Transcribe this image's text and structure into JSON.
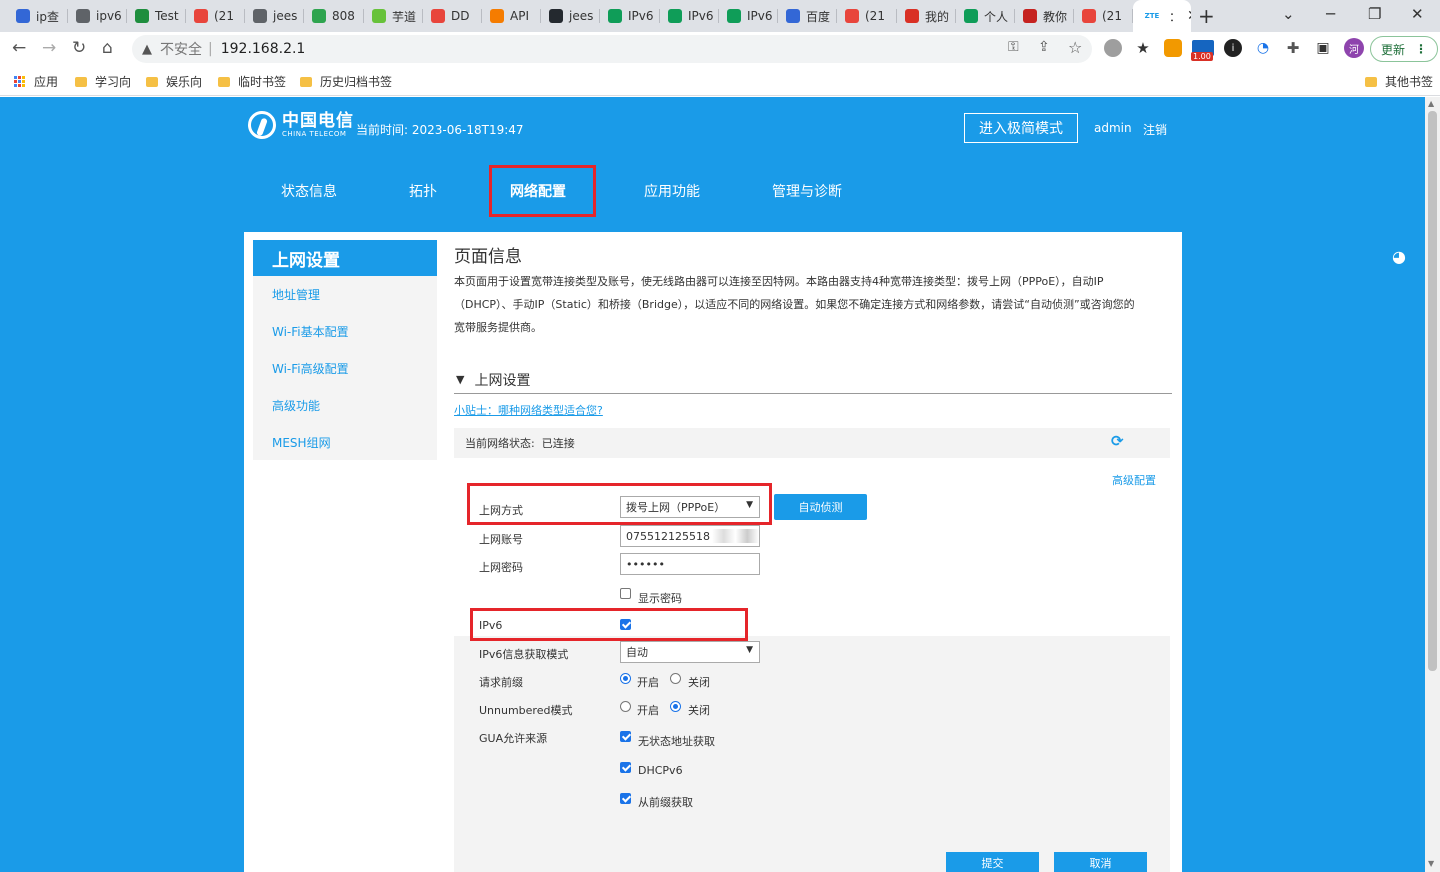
{
  "browser": {
    "tabs": [
      {
        "label": "ip查",
        "icon_color": "#3367d6",
        "icon": "paw-icon"
      },
      {
        "label": "ipv6",
        "icon_color": "#5f6368",
        "icon": "globe-icon"
      },
      {
        "label": "Test",
        "icon_color": "#1e8e3e",
        "icon": "check-icon"
      },
      {
        "label": "(21",
        "icon_color": "#e8453c",
        "icon": "c-icon"
      },
      {
        "label": "jees",
        "icon_color": "#5f6368",
        "icon": "globe-icon"
      },
      {
        "label": "808",
        "icon_color": "#2ea44f",
        "icon": "n-icon"
      },
      {
        "label": "芋道",
        "icon_color": "#67c23a",
        "icon": "sprout-icon"
      },
      {
        "label": "DD",
        "icon_color": "#e8453c",
        "icon": "note-icon"
      },
      {
        "label": "API",
        "icon_color": "#f57c00",
        "icon": "cloud-icon"
      },
      {
        "label": "jees",
        "icon_color": "#24292f",
        "icon": "github-icon"
      },
      {
        "label": "IPv6",
        "icon_color": "#0f9d58",
        "icon": "openai-icon"
      },
      {
        "label": "IPv6",
        "icon_color": "#0f9d58",
        "icon": "openai-icon"
      },
      {
        "label": "IPv6",
        "icon_color": "#0f9d58",
        "icon": "openai-icon"
      },
      {
        "label": "百度",
        "icon_color": "#3367d6",
        "icon": "paw-icon"
      },
      {
        "label": "(21",
        "icon_color": "#e8453c",
        "icon": "c-icon"
      },
      {
        "label": "我的",
        "icon_color": "#d93025",
        "icon": "pin-icon"
      },
      {
        "label": "个人",
        "icon_color": "#0f9d58",
        "icon": "openai-icon"
      },
      {
        "label": "教你",
        "icon_color": "#c5221f",
        "icon": "m-icon"
      },
      {
        "label": "(21",
        "icon_color": "#e8453c",
        "icon": "c-icon"
      },
      {
        "label": "：",
        "icon_color": "#1a9be8",
        "icon": "zte-icon",
        "favicon_text": "ZTE"
      }
    ],
    "window_controls": [
      "─",
      "❐",
      "✕"
    ],
    "address": {
      "insecure_label": "不安全",
      "url": "192.168.2.1"
    },
    "update_label": "更新",
    "extension_badge": "1.00",
    "bookmarks": [
      "应用",
      "学习向",
      "娱乐向",
      "临时书签",
      "历史归档书签"
    ],
    "other_bookmarks": "其他书签"
  },
  "header": {
    "logo_cn": "中国电信",
    "logo_en": "CHINA TELECOM",
    "time_label": "当前时间:",
    "time_value": "2023-06-18T19:47",
    "simple_mode": "进入极简模式",
    "user": "admin",
    "logout": "注销"
  },
  "mainnav": [
    "状态信息",
    "拓扑",
    "网络配置",
    "应用功能",
    "管理与诊断"
  ],
  "sidebar": {
    "title": "上网设置",
    "items": [
      "地址管理",
      "Wi-Fi基本配置",
      "Wi-Fi高级配置",
      "高级功能",
      "MESH组网"
    ]
  },
  "content": {
    "title": "页面信息",
    "desc_line1": "本页面用于设置宽带连接类型及账号，使无线路由器可以连接至因特网。本路由器支持4种宽带连接类型：拨号上网（PPPoE），自动IP",
    "desc_line2": "（DHCP）、手动IP（Static）和桥接（Bridge），以适应不同的网络设置。如果您不确定连接方式和网络参数，请尝试“自动侦测”或咨询您的",
    "desc_line3": "宽带服务提供商。",
    "section_title": "上网设置",
    "tip": "小贴士：哪种网络类型适合您?",
    "status_label": "当前网络状态:",
    "status_value": "已连接",
    "advanced": "高级配置"
  },
  "form": {
    "conn_label": "上网方式",
    "conn_value": "拨号上网（PPPoE）",
    "auto_detect": "自动侦测",
    "account_label": "上网账号",
    "account_value": "075512125518",
    "password_label": "上网密码",
    "password_value": "••••••",
    "show_password": "显示密码",
    "show_password_checked": false,
    "ipv6_label": "IPv6",
    "ipv6_checked": true,
    "ipv6_mode_label": "IPv6信息获取模式",
    "ipv6_mode_value": "自动",
    "prefix_label": "请求前缀",
    "prefix_on": "开启",
    "prefix_off": "关闭",
    "prefix_value": "开启",
    "unnumbered_label": "Unnumbered模式",
    "unnumbered_on": "开启",
    "unnumbered_off": "关闭",
    "unnumbered_value": "关闭",
    "gua_label": "GUA允许来源",
    "gua_opt1": "无状态地址获取",
    "gua_opt2": "DHCPv6",
    "gua_opt3": "从前缀获取",
    "submit": "提交",
    "cancel": "取消"
  }
}
